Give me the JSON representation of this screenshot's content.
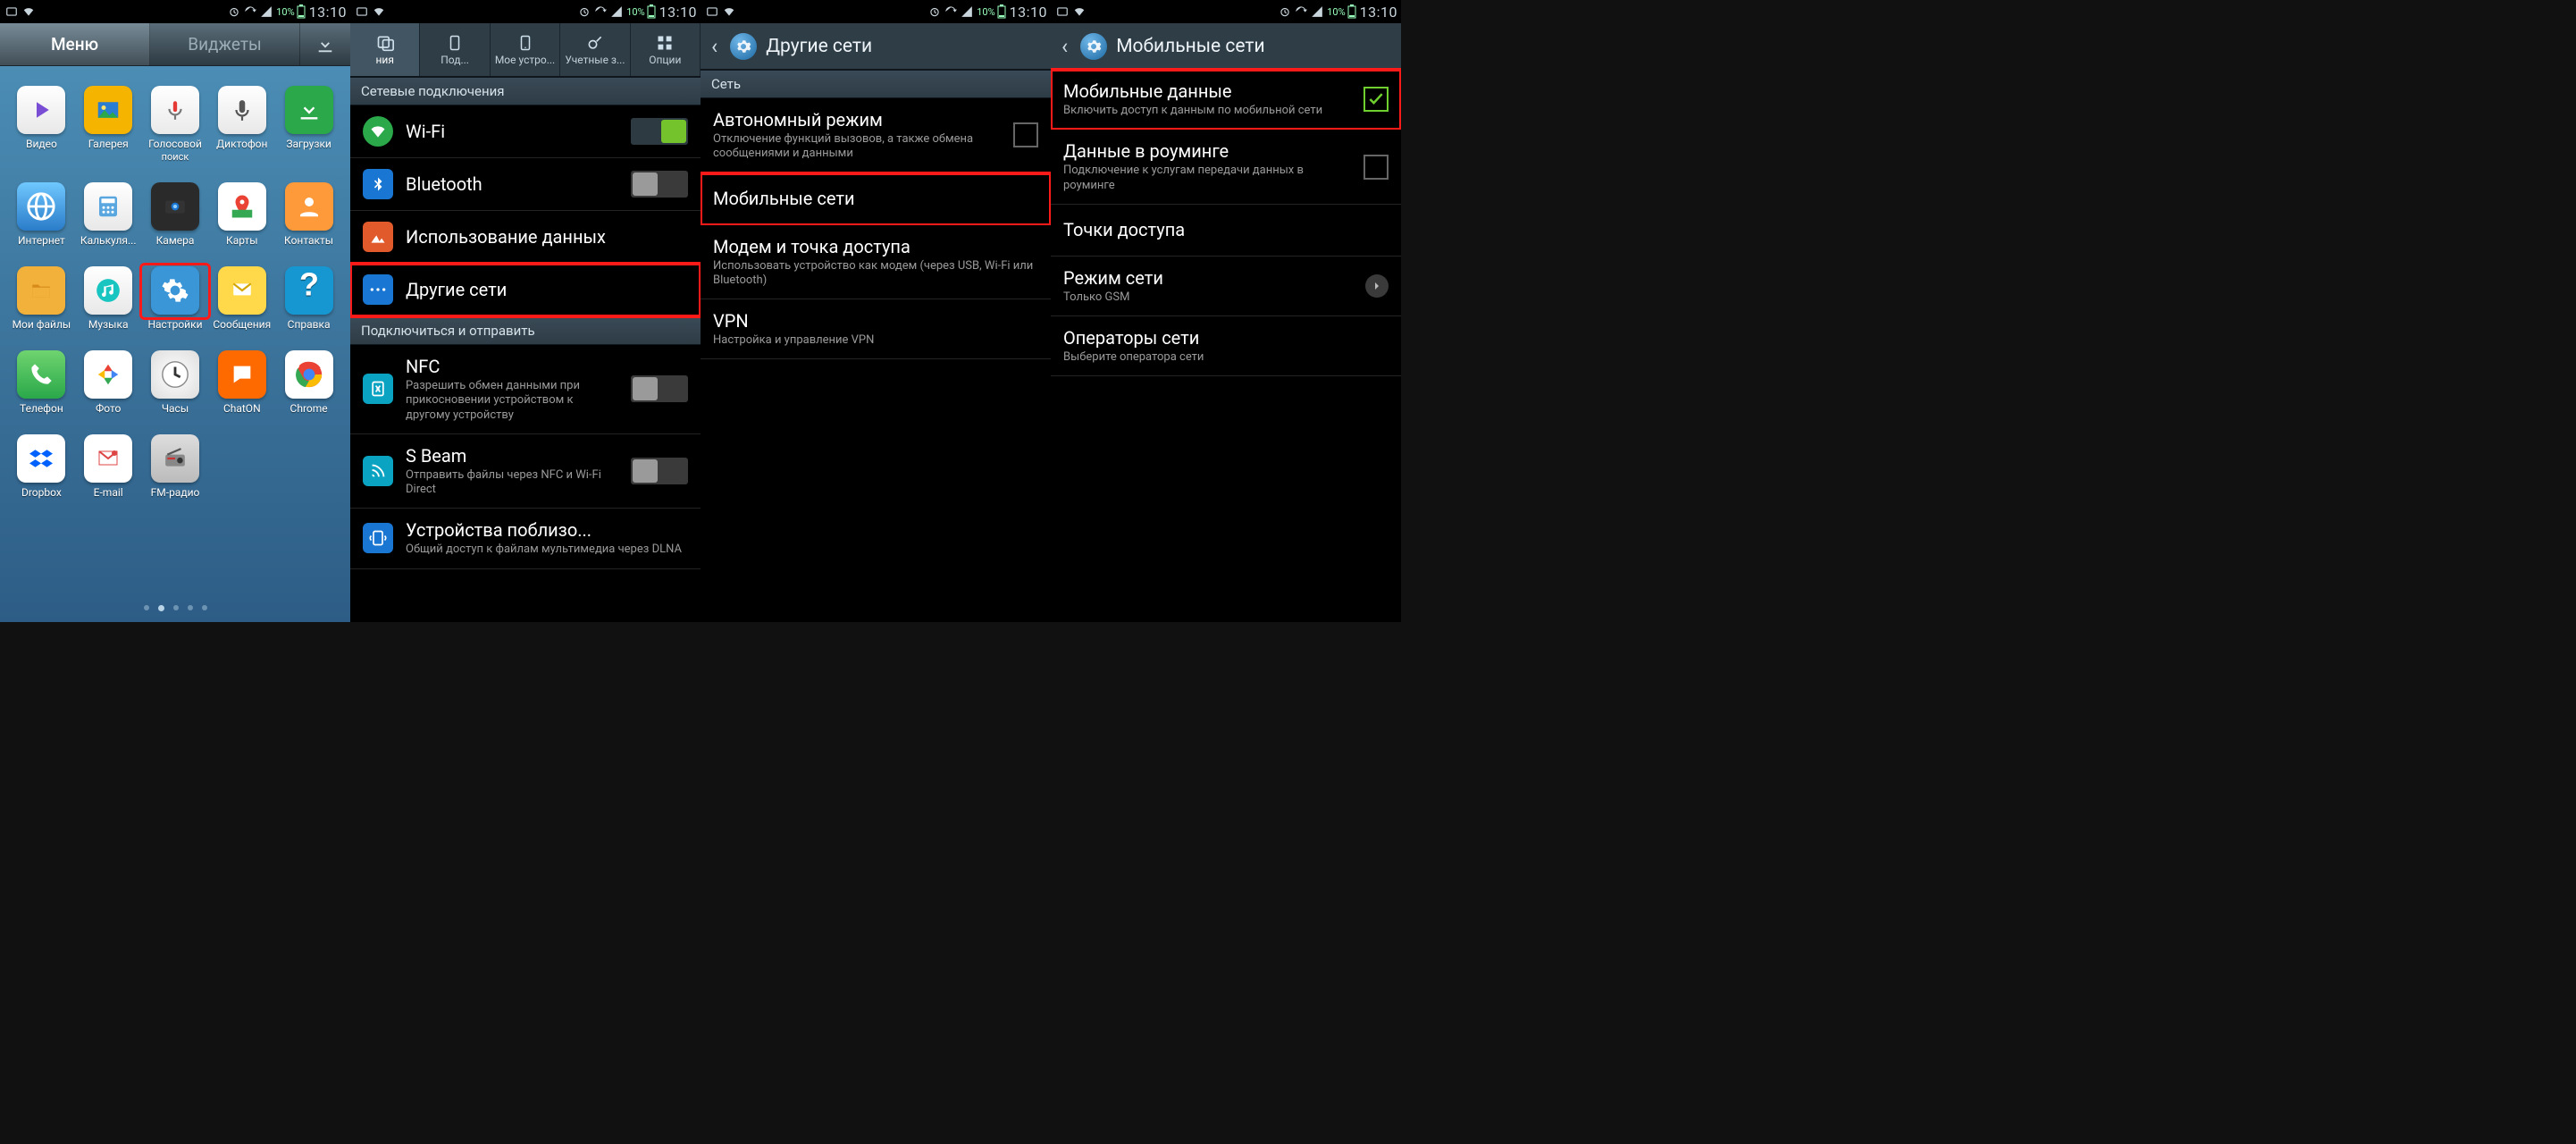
{
  "status": {
    "battery_pct": "10%",
    "time": "13:10"
  },
  "panel1": {
    "tabs": {
      "menu": "Меню",
      "widgets": "Виджеты"
    },
    "apps": [
      {
        "id": "video",
        "label": "Видео"
      },
      {
        "id": "gallery",
        "label": "Галерея"
      },
      {
        "id": "voice",
        "label": "Голосовой",
        "sub": "поиск"
      },
      {
        "id": "rec",
        "label": "Диктофон"
      },
      {
        "id": "dl",
        "label": "Загрузки"
      },
      {
        "id": "ie",
        "label": "Интернет"
      },
      {
        "id": "calc",
        "label": "Калькуля..."
      },
      {
        "id": "cam",
        "label": "Камера"
      },
      {
        "id": "maps",
        "label": "Карты"
      },
      {
        "id": "contacts",
        "label": "Контакты"
      },
      {
        "id": "files",
        "label": "Мои файлы"
      },
      {
        "id": "music",
        "label": "Музыка"
      },
      {
        "id": "settings",
        "label": "Настройки",
        "highlight": true
      },
      {
        "id": "msg",
        "label": "Сообщения"
      },
      {
        "id": "help",
        "label": "Справка"
      },
      {
        "id": "phone",
        "label": "Телефон"
      },
      {
        "id": "photos",
        "label": "Фото"
      },
      {
        "id": "clock",
        "label": "Часы"
      },
      {
        "id": "chaton",
        "label": "ChatON"
      },
      {
        "id": "chrome",
        "label": "Chrome"
      },
      {
        "id": "dropbox",
        "label": "Dropbox"
      },
      {
        "id": "email",
        "label": "E-mail"
      },
      {
        "id": "radio",
        "label": "FM-радио"
      }
    ]
  },
  "panel2": {
    "tabs": [
      "ния",
      "Под...",
      "Мое устро...",
      "Учетные з...",
      "Опции"
    ],
    "section1": "Сетевые подключения",
    "items1": [
      {
        "id": "wifi",
        "title": "Wi-Fi",
        "switch": "on"
      },
      {
        "id": "bt",
        "title": "Bluetooth",
        "switch": "off"
      },
      {
        "id": "datausage",
        "title": "Использование данных"
      },
      {
        "id": "morenets",
        "title": "Другие сети",
        "highlight": true
      }
    ],
    "section2": "Подключиться и отправить",
    "items2": [
      {
        "id": "nfc",
        "title": "NFC",
        "sub": "Разрешить обмен данными при прикосновении устройством к другому устройству",
        "switch": "off"
      },
      {
        "id": "sbeam",
        "title": "S Beam",
        "sub": "Отправить файлы через NFC и Wi-Fi Direct",
        "switch": "off"
      },
      {
        "id": "nearby",
        "title": "Устройства поблизо...",
        "sub": "Общий доступ к файлам мультимедиа через DLNA"
      }
    ]
  },
  "panel3": {
    "title": "Другие сети",
    "section": "Сеть",
    "items": [
      {
        "id": "airplane",
        "title": "Автономный режим",
        "sub": "Отключение функций вызовов, а также обмена сообщениями и данными",
        "checkbox": "off"
      },
      {
        "id": "mobilenets",
        "title": "Мобильные сети",
        "highlight": true
      },
      {
        "id": "tether",
        "title": "Модем и точка доступа",
        "sub": "Использовать устройство как модем (через USB, Wi-Fi или Bluetooth)"
      },
      {
        "id": "vpn",
        "title": "VPN",
        "sub": "Настройка и управление VPN"
      }
    ]
  },
  "panel4": {
    "title": "Мобильные сети",
    "items": [
      {
        "id": "mobiledata",
        "title": "Мобильные данные",
        "sub": "Включить доступ к данным по мобильной сети",
        "checkbox": "on",
        "highlight": true
      },
      {
        "id": "roaming",
        "title": "Данные в роуминге",
        "sub": "Подключение к услугам передачи данных в роуминге",
        "checkbox": "off"
      },
      {
        "id": "apn",
        "title": "Точки доступа"
      },
      {
        "id": "netmode",
        "title": "Режим сети",
        "sub": "Только GSM",
        "chevron": true
      },
      {
        "id": "operators",
        "title": "Операторы сети",
        "sub": "Выберите оператора сети"
      }
    ]
  }
}
